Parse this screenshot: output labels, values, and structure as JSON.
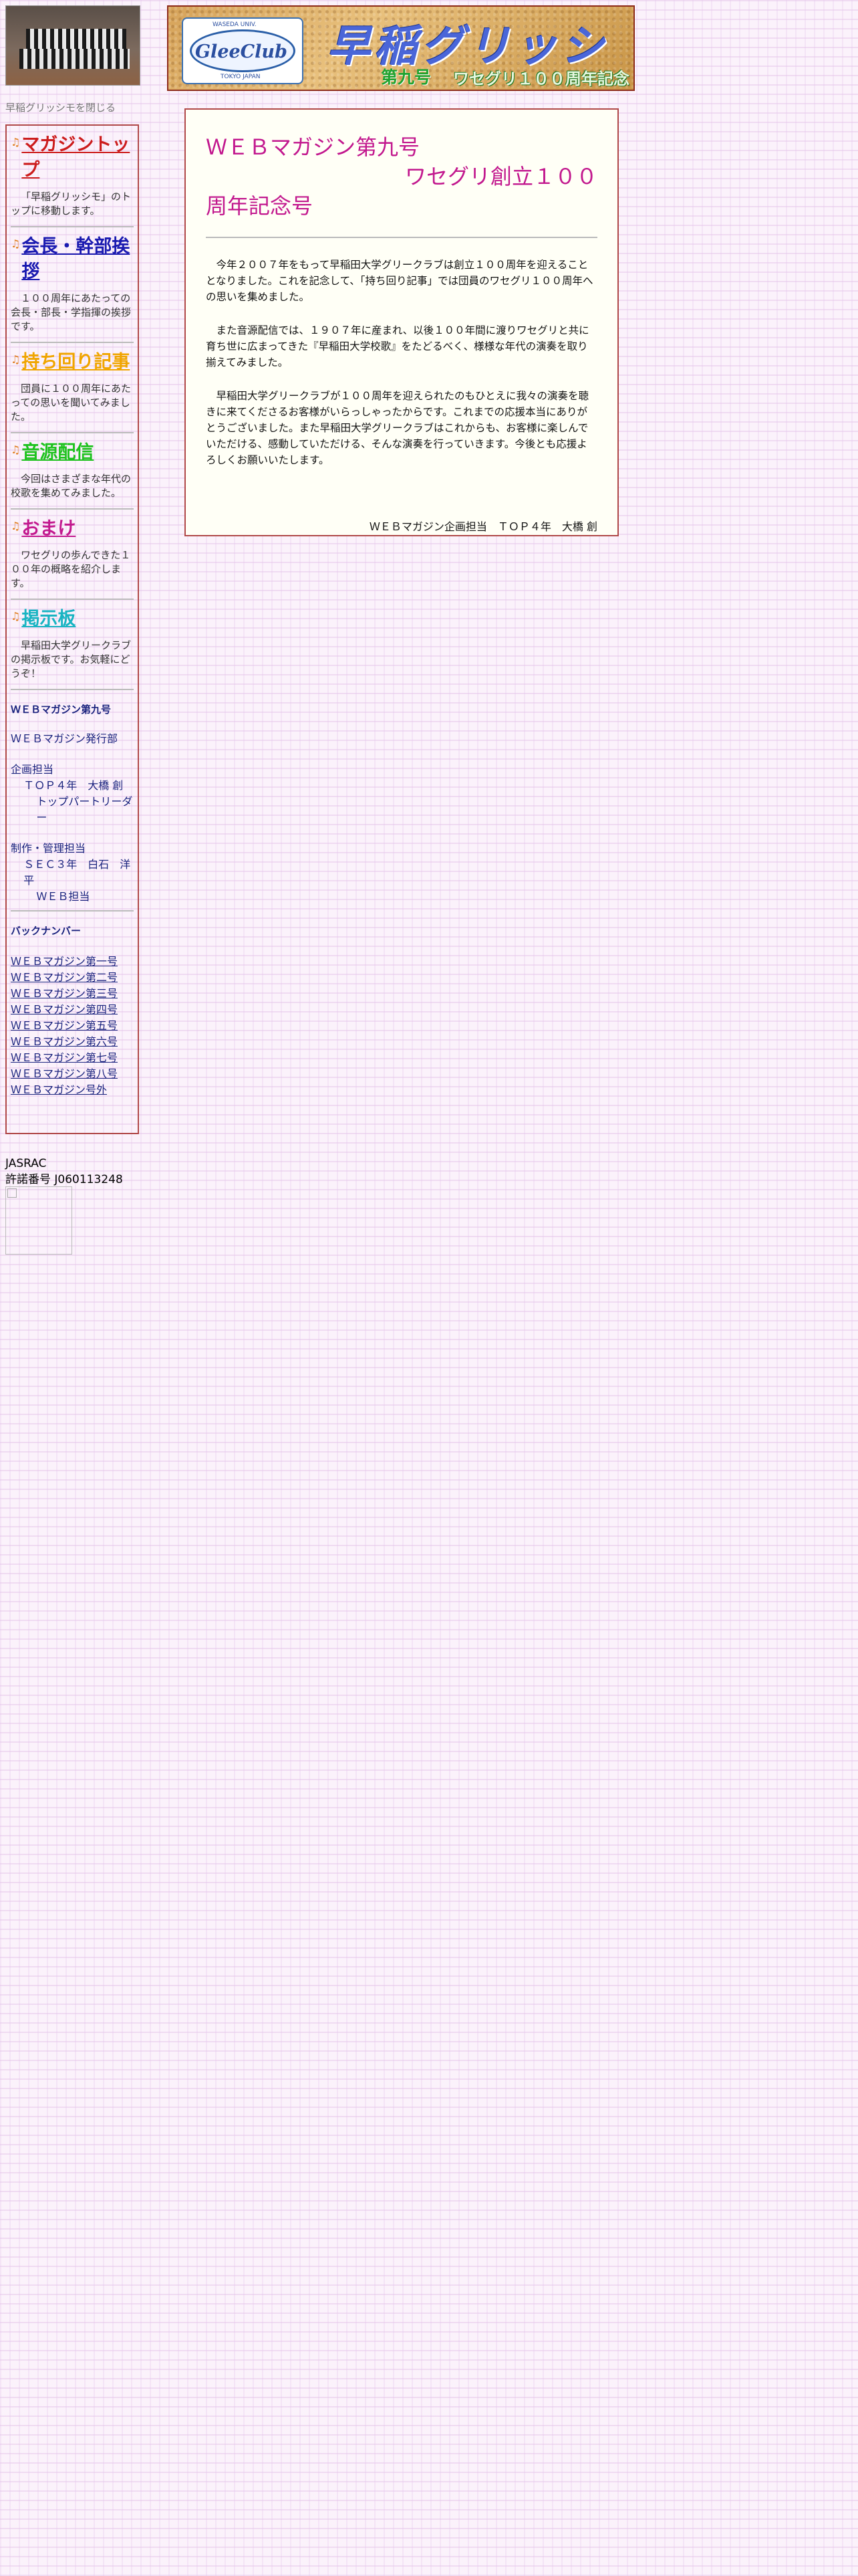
{
  "sidebar": {
    "close_link": "早稲グリッシモを閉じる",
    "menu": [
      {
        "label": "マガジントップ",
        "color": "#cc1d1d",
        "desc": "「早稲グリッシモ」のトップに移動します。"
      },
      {
        "label": "会長・幹部挨拶",
        "color": "#1a1ab0",
        "desc": "１００周年にあたっての会長・部長・学指揮の挨拶です。"
      },
      {
        "label": "持ち回り記事",
        "color": "#f0a500",
        "desc": "団員に１００周年にあたっての思いを聞いてみました。"
      },
      {
        "label": "音源配信",
        "color": "#1ec21e",
        "desc": "今回はさまざまな年代の校歌を集めてみました。"
      },
      {
        "label": "おまけ",
        "color": "#c2188e",
        "desc": "ワセグリの歩んできた１００年の概略を紹介します。"
      },
      {
        "label": "掲示板",
        "color": "#18b4c2",
        "desc": "早稲田大学グリークラブの掲示板です。お気軽にどうぞ！"
      }
    ],
    "magazine": {
      "title": "ＷＥＢマガジン第九号",
      "publisher": "ＷＥＢマガジン発行部",
      "planning_label": "企画担当",
      "planning_name": "ＴＯＰ４年　大橋 創",
      "planning_role": "トップパートリーダー",
      "production_label": "制作・管理担当",
      "production_name": "ＳＥＣ３年　白石　洋平",
      "production_role": "ＷＥＢ担当"
    },
    "back_numbers": {
      "title": "バックナンバー",
      "items": [
        "ＷＥＢマガジン第一号",
        "ＷＥＢマガジン第二号",
        "ＷＥＢマガジン第三号",
        "ＷＥＢマガジン第四号",
        "ＷＥＢマガジン第五号",
        "ＷＥＢマガジン第六号",
        "ＷＥＢマガジン第七号",
        "ＷＥＢマガジン第八号",
        "ＷＥＢマガジン号外"
      ]
    },
    "jasrac": "JASRAC",
    "license": "許諾番号 J060113248"
  },
  "banner": {
    "logo_text": "GleeClub",
    "logo_top": "WASEDA UNIV.",
    "logo_bottom": "TOKYO JAPAN",
    "title": "早稲グリッシモ",
    "issue": "第九号",
    "subtitle": "ワセグリ１００周年記念"
  },
  "main": {
    "heading_line1": "ＷＥＢマガジン第九号",
    "heading_line2": "ワセグリ創立１００",
    "heading_line3": "周年記念号",
    "paragraphs": [
      "今年２００７年をもって早稲田大学グリークラブは創立１００周年を迎えることとなりました。これを記念して、「持ち回り記事」では団員のワセグリ１００周年への思いを集めました。",
      "また音源配信では、１９０７年に産まれ、以後１００年間に渡りワセグリと共に育ち世に広まってきた『早稲田大学校歌』をたどるべく、様様な年代の演奏を取り揃えてみました。",
      "早稲田大学グリークラブが１００周年を迎えられたのもひとえに我々の演奏を聴きに来てくださるお客様がいらっしゃったからです。これまでの応援本当にありがとうございました。また早稲田大学グリークラブはこれからも、お客様に楽しんでいただける、感動していただける、そんな演奏を行っていきます。今後とも応援よろしくお願いいたします。"
    ],
    "signature": "ＷＥＢマガジン企画担当　ＴＯＰ４年　大橋 創"
  }
}
